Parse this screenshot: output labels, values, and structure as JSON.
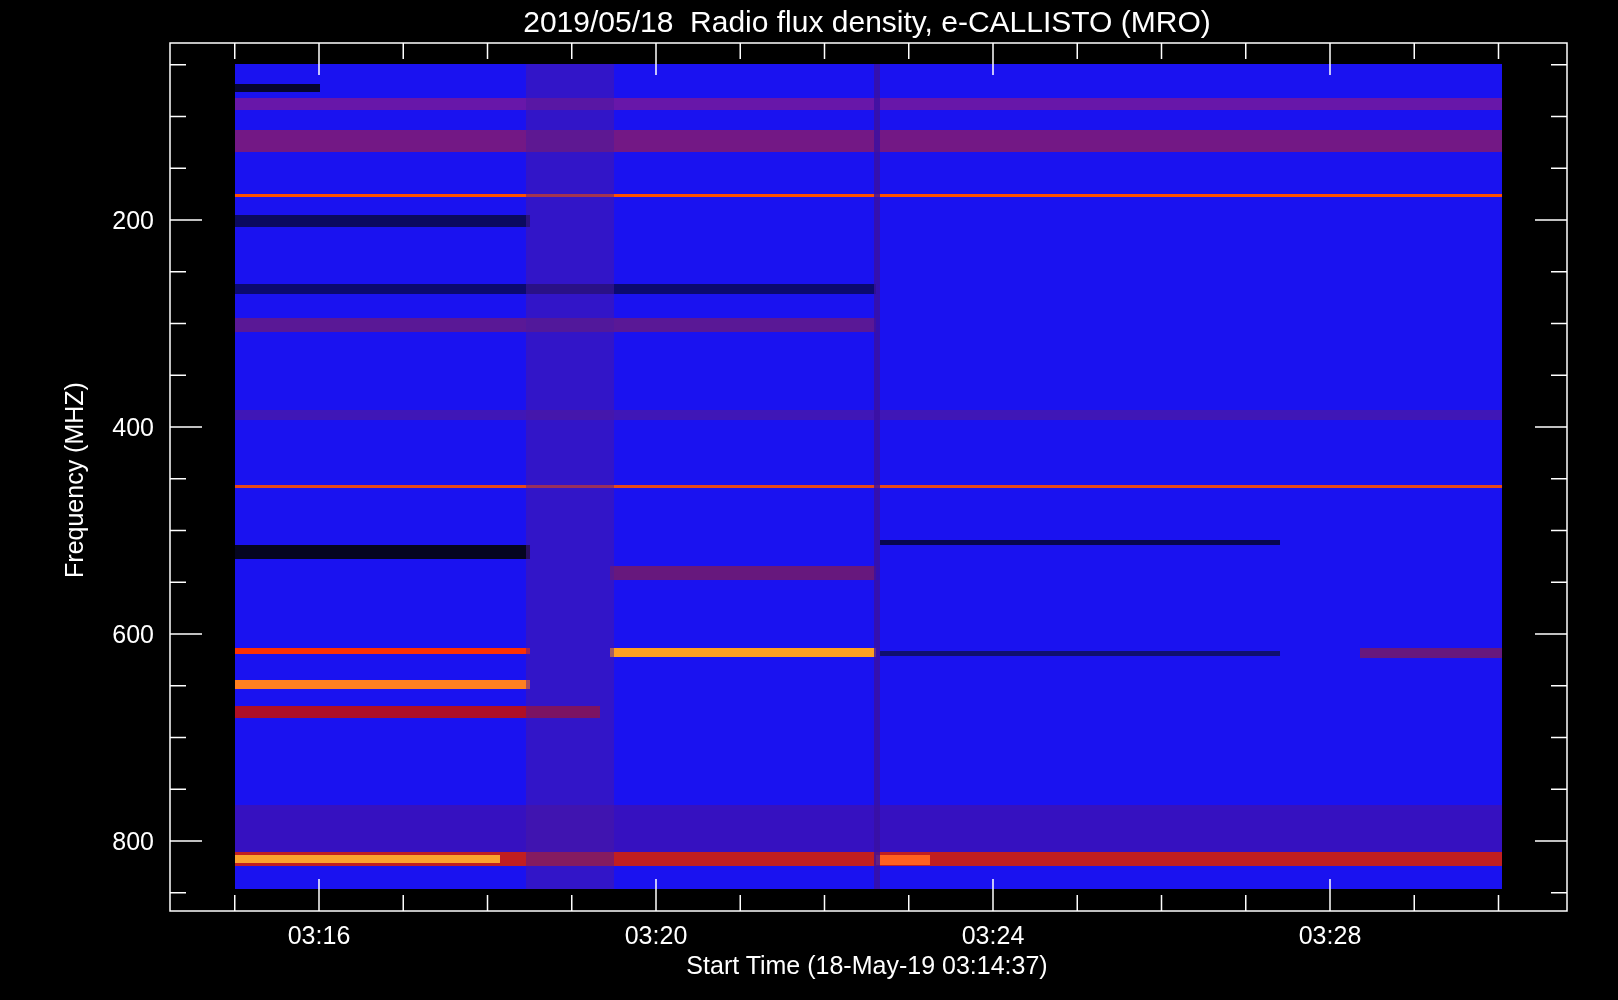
{
  "title": "2019/05/18  Radio flux density, e-CALLISTO (MRO)",
  "y_axis": {
    "label": "Frequency (MHZ)",
    "ticks": [
      "200",
      "400",
      "600",
      "800"
    ]
  },
  "x_axis": {
    "label": "Start Time (18-May-19 03:14:37)",
    "ticks": [
      "03:16",
      "03:20",
      "03:24",
      "03:28"
    ]
  }
}
